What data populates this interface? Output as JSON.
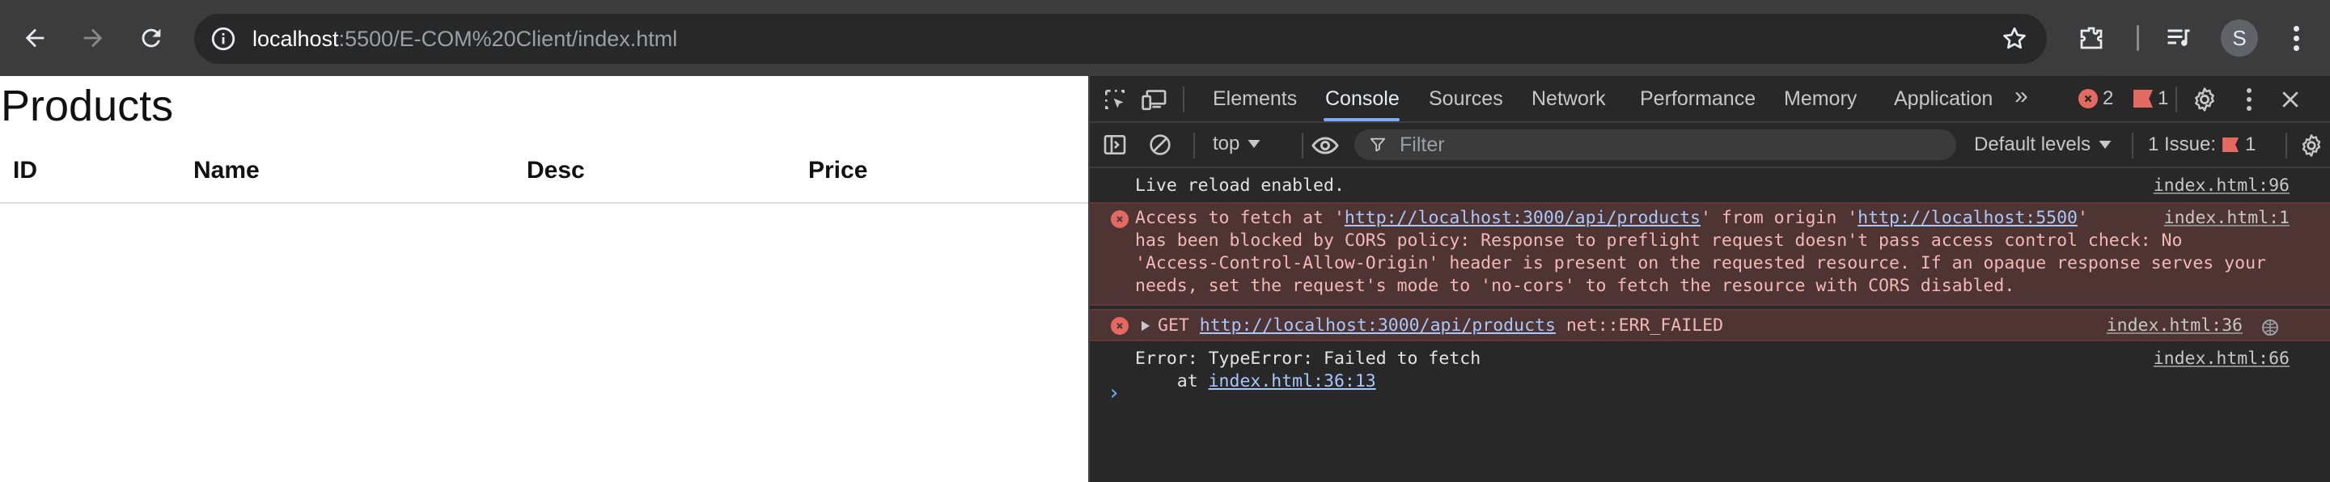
{
  "browser": {
    "url_host": "localhost",
    "url_rest": ":5500/E-COM%20Client/index.html",
    "profile_initial": "S"
  },
  "page": {
    "title": "Products",
    "columns": [
      "ID",
      "Name",
      "Desc",
      "Price"
    ]
  },
  "devtools": {
    "tabs": [
      "Elements",
      "Console",
      "Sources",
      "Network",
      "Performance",
      "Memory",
      "Application"
    ],
    "active_tab": "Console",
    "more_tabs": "»",
    "error_count": "2",
    "warning_count": "1",
    "context": "top",
    "filter_placeholder": "Filter",
    "levels": "Default levels",
    "issues_label": "1 Issue:",
    "issues_count": "1",
    "messages": {
      "m1": {
        "text": "Live reload enabled.",
        "source": "index.html:96"
      },
      "m2": {
        "l1_a": "Access to fetch at '",
        "l1_link1": "http://localhost:3000/api/products",
        "l1_b": "' from origin '",
        "l1_link2": "http://localhost:5500",
        "l1_c": "'",
        "l2": "has been blocked by CORS policy: Response to preflight request doesn't pass access control check: No",
        "l3": "'Access-Control-Allow-Origin' header is present on the requested resource. If an opaque response serves your",
        "l4": "needs, set the request's mode to 'no-cors' to fetch the resource with CORS disabled.",
        "source": "index.html:1"
      },
      "m3": {
        "method": "GET",
        "link": "http://localhost:3000/api/products",
        "status": "net::ERR_FAILED",
        "source": "index.html:36"
      },
      "m4": {
        "l1": "Error: TypeError: Failed to fetch",
        "l2_prefix": "    at ",
        "l2_link": "index.html:36:13",
        "source": "index.html:66"
      }
    },
    "prompt": "›"
  },
  "colors": {
    "toolbar_bg": "#3c3c3c",
    "omnibox_bg": "#282828",
    "devtools_bg": "#282828",
    "error_bg": "#4e3534",
    "error_red": "#e46962",
    "link_blue": "#a8c7fa",
    "active_tab_underline": "#7cacf8"
  }
}
